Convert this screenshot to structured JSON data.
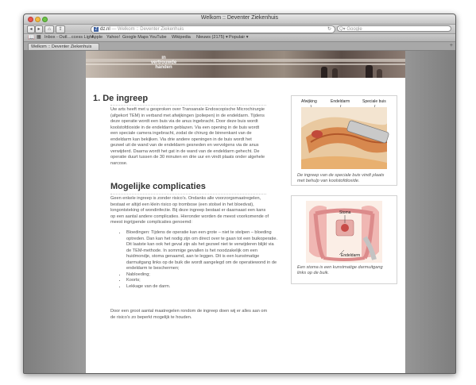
{
  "window": {
    "title": "Welkom :: Deventer Ziekenhuis"
  },
  "toolbar": {
    "back": "◂",
    "forward": "▸",
    "home": "⌂",
    "share": "⇪",
    "url_host": "dz.nl",
    "url_rest": "— Welkom :: Deventer Ziekenhuis",
    "reload": "↻",
    "search_placeholder": "Q▾ Google"
  },
  "bookmarks": [
    "Inbox - Outl…ccess Light",
    "Apple",
    "Yahoo!",
    "Google Maps",
    "YouTube",
    "Wikipedia",
    "Nieuws (2175) ▾",
    "Populair ▾"
  ],
  "tab": {
    "label": "Welkom :: Deventer Ziekenhuis"
  },
  "banner": {
    "line1": "in",
    "line2": "vertrouwde",
    "line3": "handen"
  },
  "article": {
    "heading1": "1. De ingreep",
    "p1": "Uw arts heeft met u gesproken over Transanale Endoscopische Microchirurgie (afgekort TEM) in verband met afwijkingen (poliepen) in de endeldarm. Tijdens deze operatie wordt een buis via de anus ingebracht. Door deze buis wordt koolstofdioxide in de endeldarm geblazen. Via een opening in de buis wordt een speciale camera ingebracht, zodat de chirurg de binnenkant van de endeldarm kan bekijken. Via drie andere openingen in de buis wordt het gezwel uit de wand van de endeldarm gesneden en vervolgens via de anus verwijderd. Daarna wordt het gat in de wand van de endeldarm gehecht. De operatie duurt tussen de 30 minuten en drie uur en vindt plaats onder algehele narcose.",
    "heading2": "Mogelijke complicaties",
    "p2": "Geen enkele ingreep is zonder risico's. Ondanks alle voorzorgsmaatregelen, bestaat er altijd een klein risico op trombose (een stolsel in het bloedvat), longontsteking of wondinfectie. Bij deze ingreep bestaat er daarnaast een kans op een aantal andere complicaties. Hieronder worden de meest voorkomende of meest ingrijpende complicaties genoemd:",
    "bullets": [
      "Bloedingen: Tijdens de operatie kan een grote – niet te stelpen – bloeding optreden. Dan kan het nodig zijn om direct over te gaan tot een buikoperatie. Dit laatste kan ook het geval zijn als het gezwel niet te verwijderen blijkt via de TEM-methode. In sommige gevallen is het noodzakelijk om een huidmondje, stoma genaamd, aan te leggen. Dit is een kunstmatige darmuitgang links op de buik die wordt aangelegd om de operatiewond in de endeldarm te beschermen;",
      "Nabloeding;",
      "Koorts;",
      "Lekkage van de darm."
    ],
    "p3": "Door een groot aantal maatregelen rondom de ingreep doen wij er alles aan om de risico's zo beperkt mogelijk te houden."
  },
  "figure1": {
    "labels": [
      "Afwijking",
      "Endeldarm",
      "Speciale buis"
    ],
    "caption": "De ingreep van de speciale buis vindt plaats met behulp van koolstofdioxide."
  },
  "figure2": {
    "labels": [
      "Stoma",
      "Endeldarm"
    ],
    "caption": "Een stoma is een kunstmatige darmuitgang links op de buik."
  },
  "colors": {
    "heading": "#333333",
    "text": "#555555",
    "page_bg": "#ffffff",
    "chrome_bg": "#a3a3a3"
  }
}
